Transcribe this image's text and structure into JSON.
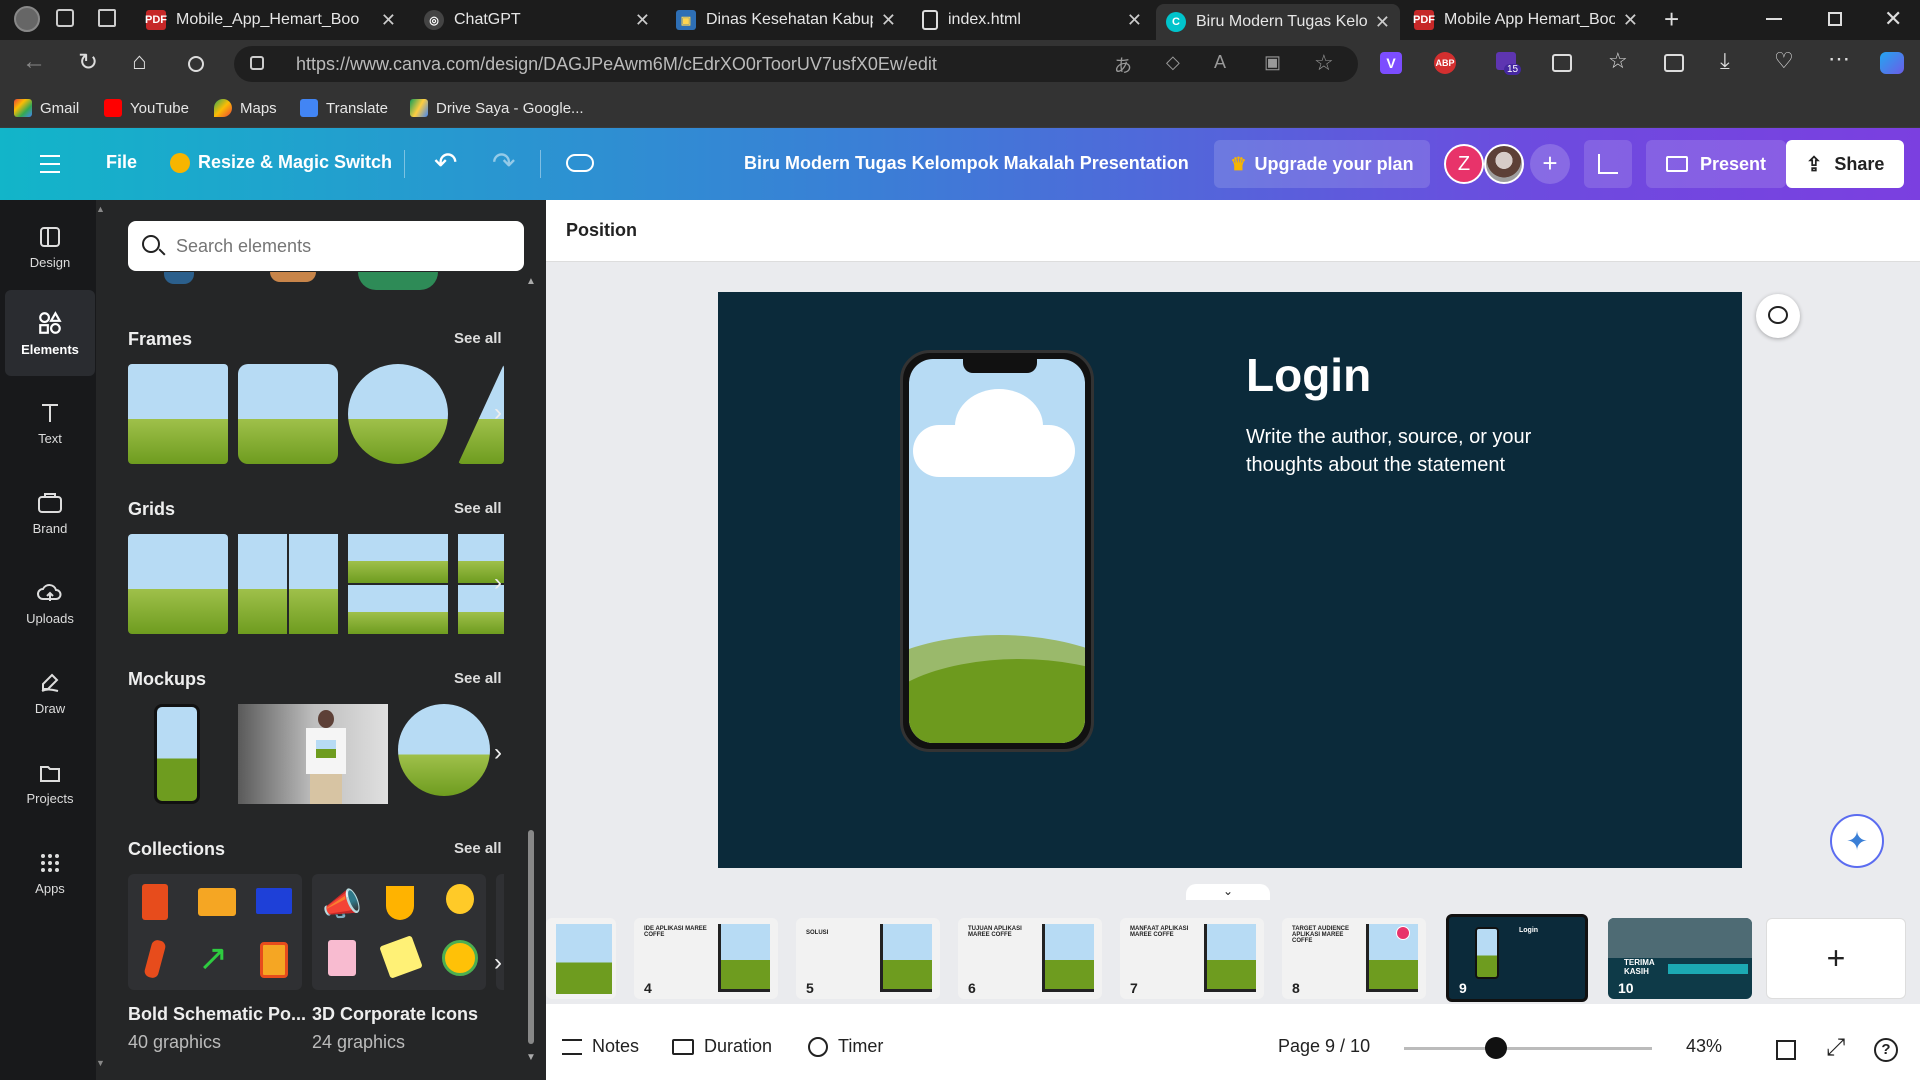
{
  "browser": {
    "tabs": [
      {
        "label": "Mobile_App_Hemart_Boo",
        "icon": "pdf-icon"
      },
      {
        "label": "ChatGPT",
        "icon": "chatgpt-icon"
      },
      {
        "label": "Dinas Kesehatan Kabupat",
        "icon": "gov-icon"
      },
      {
        "label": "index.html",
        "icon": "file-icon"
      },
      {
        "label": "Biru Modern Tugas Kelom",
        "icon": "canva-icon",
        "active": true
      },
      {
        "label": "Mobile App Hemart_Boo",
        "icon": "pdf-icon"
      }
    ],
    "url": "https://www.canva.com/design/DAGJPeAwm6M/cEdrXO0rToorUV7usfX0Ew/edit",
    "extension_badge": "15",
    "bookmarks": [
      "Gmail",
      "YouTube",
      "Maps",
      "Translate",
      "Drive Saya - Google..."
    ]
  },
  "header": {
    "file_label": "File",
    "resize_label": "Resize & Magic Switch",
    "title": "Biru Modern Tugas Kelompok Makalah Presentation",
    "upgrade_label": "Upgrade your plan",
    "avatar_letter": "Z",
    "present_label": "Present",
    "share_label": "Share"
  },
  "rail": [
    {
      "label": "Design",
      "icon": "design-icon"
    },
    {
      "label": "Elements",
      "icon": "elements-icon",
      "active": true
    },
    {
      "label": "Text",
      "icon": "text-icon"
    },
    {
      "label": "Brand",
      "icon": "brand-icon"
    },
    {
      "label": "Uploads",
      "icon": "uploads-icon"
    },
    {
      "label": "Draw",
      "icon": "draw-icon"
    },
    {
      "label": "Projects",
      "icon": "projects-icon"
    },
    {
      "label": "Apps",
      "icon": "apps-icon"
    }
  ],
  "panel": {
    "search_placeholder": "Search elements",
    "see_all": "See all",
    "sections": {
      "frames": "Frames",
      "grids": "Grids",
      "mockups": "Mockups",
      "collections": "Collections"
    },
    "collections": [
      {
        "title": "Bold Schematic Po...",
        "count": "40 graphics"
      },
      {
        "title": "3D Corporate Icons",
        "count": "24 graphics"
      }
    ]
  },
  "toolbar": {
    "position_label": "Position"
  },
  "slide": {
    "heading": "Login",
    "body_line1": "Write the author, source, or your",
    "body_line2": "thoughts about the statement"
  },
  "filmstrip": {
    "pages": [
      {
        "num": "",
        "title": ""
      },
      {
        "num": "4",
        "title": "IDE APLIKASI MAREE COFFE"
      },
      {
        "num": "5",
        "title": "SOLUSI"
      },
      {
        "num": "6",
        "title": "TUJUAN APLIKASI MAREE COFFE"
      },
      {
        "num": "7",
        "title": "MANFAAT APLIKASI MAREE COFFE"
      },
      {
        "num": "8",
        "title": "TARGET AUDIENCE APLIKASI MAREE COFFE"
      },
      {
        "num": "9",
        "title": "Login"
      },
      {
        "num": "10",
        "title": "TERIMA KASIH"
      }
    ]
  },
  "bottom": {
    "notes": "Notes",
    "duration": "Duration",
    "timer": "Timer",
    "page_indicator": "Page 9 / 10",
    "zoom_value": 0.37,
    "zoom_label": "43%"
  },
  "colors": {
    "slide_bg": "#0b2a3a",
    "accent": "#7d2ae8",
    "avatar": "#e8336a"
  }
}
